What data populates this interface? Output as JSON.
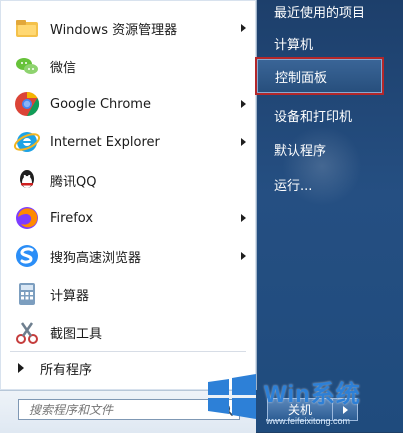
{
  "left_programs": [
    {
      "label": "Windows 资源管理器",
      "icon": "folder-icon",
      "has_arrow": true
    },
    {
      "label": "微信",
      "icon": "wechat-icon",
      "has_arrow": false
    },
    {
      "label": "Google Chrome",
      "icon": "chrome-icon",
      "has_arrow": true
    },
    {
      "label": "Internet Explorer",
      "icon": "ie-icon",
      "has_arrow": true
    },
    {
      "label": "腾讯QQ",
      "icon": "qq-icon",
      "has_arrow": false
    },
    {
      "label": "Firefox",
      "icon": "firefox-icon",
      "has_arrow": true
    },
    {
      "label": "搜狗高速浏览器",
      "icon": "sogou-browser-icon",
      "has_arrow": true
    },
    {
      "label": "计算器",
      "icon": "calculator-icon",
      "has_arrow": false
    },
    {
      "label": "截图工具",
      "icon": "snipping-tool-icon",
      "has_arrow": false
    }
  ],
  "all_programs": "所有程序",
  "search": {
    "placeholder": "搜索程序和文件"
  },
  "right_menu": [
    {
      "label": "最近使用的项目"
    },
    {
      "label": "计算机"
    },
    {
      "label": "控制面板",
      "highlighted": true
    },
    {
      "label": "设备和打印机"
    },
    {
      "label": "默认程序"
    },
    {
      "label": "运行..."
    }
  ],
  "shutdown": {
    "label": "关机"
  },
  "watermark": {
    "site": "Win系统",
    "url": "www.feifeixitong.com"
  }
}
